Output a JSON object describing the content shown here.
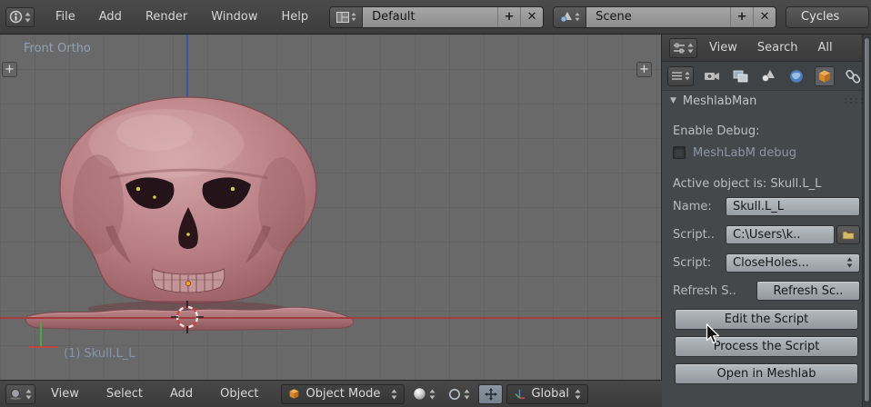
{
  "ui": {
    "plus": "+",
    "close": "✕",
    "tri_down": "▼"
  },
  "topbar": {
    "menus": [
      "File",
      "Add",
      "Render",
      "Window",
      "Help"
    ],
    "layout": {
      "value": "Default"
    },
    "scene": {
      "value": "Scene"
    },
    "engine": "Cycles"
  },
  "viewport": {
    "view_label": "Front Ortho",
    "active_object_label": "(1) Skull.L_L"
  },
  "properties": {
    "header_menus": [
      "View",
      "Search",
      "All"
    ],
    "panel": {
      "title": "MeshlabMan",
      "enable_debug_label": "Enable Debug:",
      "debug_checkbox_label": "MeshLabM debug",
      "active_object_text": "Active object is: Skull.L_L",
      "name_label": "Name:",
      "name_value": "Skull.L_L",
      "script_path_label": "Script..",
      "script_path_value": "C:\\Users\\k..",
      "script_label": "Script:",
      "script_value": "CloseHoles...",
      "refresh_label": "Refresh S..",
      "refresh_button_label": "Refresh Sc..",
      "edit_button_label": "Edit the Script",
      "process_button_label": "Process the Script",
      "open_button_label": "Open in Meshlab"
    }
  },
  "bottombar": {
    "menus": [
      "View",
      "Select",
      "Add",
      "Object"
    ],
    "mode_value": "Object Mode",
    "orientation_value": "Global"
  }
}
